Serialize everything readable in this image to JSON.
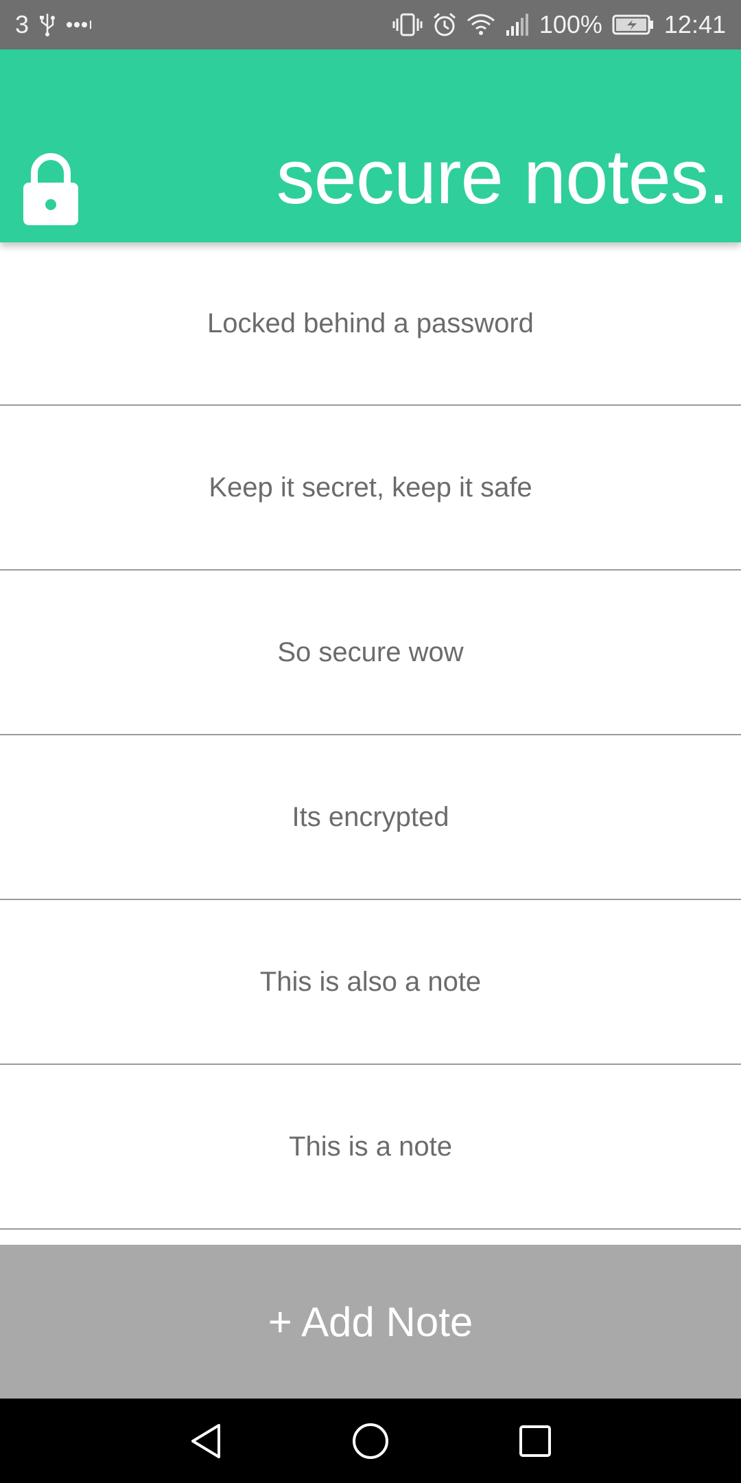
{
  "status_bar": {
    "left_text": "3",
    "battery": "100%",
    "time": "12:41",
    "icons": [
      "usb-icon",
      "more-dots-icon",
      "vibrate-icon",
      "alarm-icon",
      "wifi-icon",
      "signal-icon",
      "battery-charging-icon"
    ]
  },
  "header": {
    "title": "secure notes.",
    "icon": "lock-icon",
    "background_color": "#2ecf9a"
  },
  "notes": [
    {
      "text": "Locked behind a password"
    },
    {
      "text": "Keep it secret, keep it safe"
    },
    {
      "text": "So secure wow"
    },
    {
      "text": "Its encrypted"
    },
    {
      "text": "This is also a note"
    },
    {
      "text": "This is a note"
    }
  ],
  "add_button": {
    "label": "+ Add Note",
    "background_color": "#a9a9a9"
  },
  "nav_bar": {
    "icons": [
      "back-icon",
      "home-icon",
      "recents-icon"
    ]
  }
}
